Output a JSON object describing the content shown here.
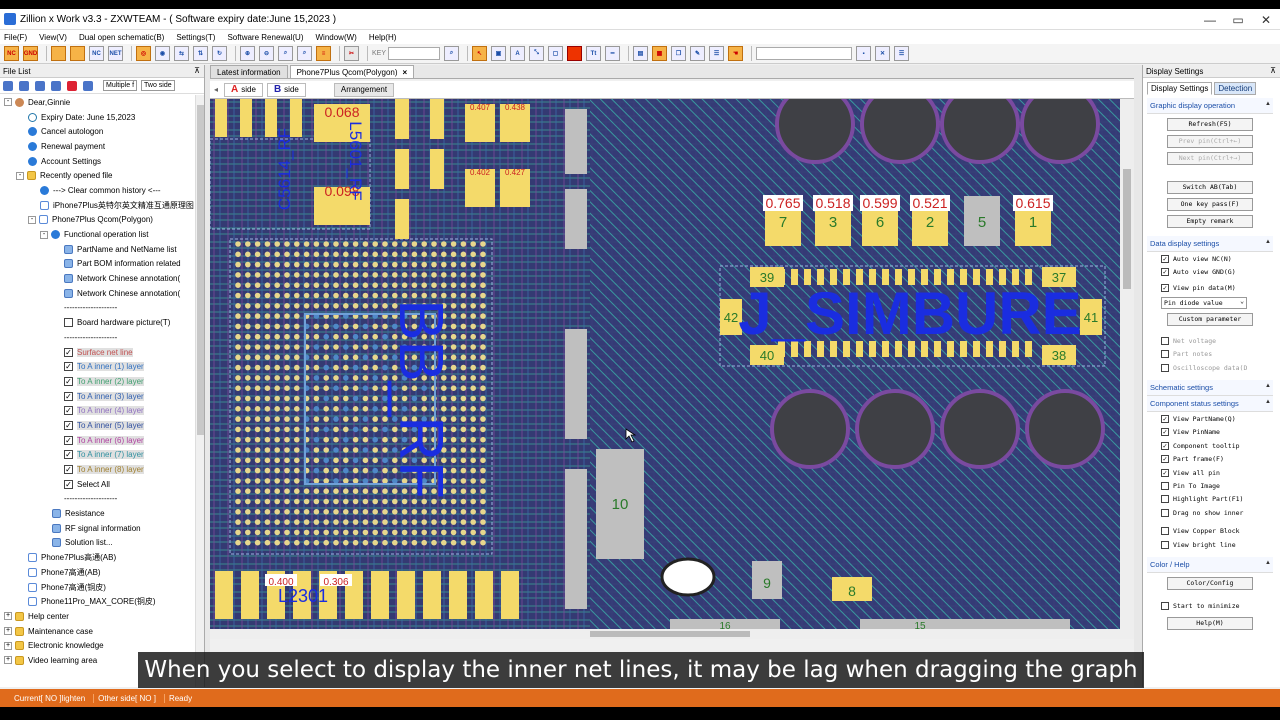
{
  "title": "Zillion x Work v3.3 - ZXWTEAM - ( Software expiry date:June 15,2023 )",
  "window_controls": [
    "—",
    "▭",
    "✕"
  ],
  "menu": [
    "File(F)",
    "View(V)",
    "Dual open schematic(B)",
    "Settings(T)",
    "Software Renewal(U)",
    "Window(W)",
    "Help(H)"
  ],
  "toolbar": {
    "key_label": "KEY"
  },
  "left_panel": {
    "header": "File List",
    "mode_select": "Multiple f",
    "side_select": "Two side",
    "tree": [
      {
        "indent": 0,
        "icon": "person",
        "label": "Dear,Ginnie",
        "exp": "-"
      },
      {
        "indent": 2,
        "icon": "clock",
        "label": "Expiry Date: June 15,2023"
      },
      {
        "indent": 2,
        "icon": "gear",
        "label": "Cancel autologon"
      },
      {
        "indent": 2,
        "icon": "gear",
        "label": "Renewal payment"
      },
      {
        "indent": 2,
        "icon": "gear",
        "label": "Account Settings"
      },
      {
        "indent": 1,
        "icon": "folder",
        "label": "Recently opened file",
        "exp": "-"
      },
      {
        "indent": 3,
        "icon": "gear",
        "label": "---> Clear common history <---"
      },
      {
        "indent": 3,
        "icon": "page",
        "label": "iPhone7Plus英特尔英文精准互通原理图"
      },
      {
        "indent": 2,
        "icon": "page",
        "label": "Phone7Plus Qcom(Polygon)",
        "exp": "-"
      },
      {
        "indent": 3,
        "icon": "gear",
        "label": "Functional operation list",
        "exp": "-"
      },
      {
        "indent": 5,
        "icon": "net",
        "label": "PartName and NetName list"
      },
      {
        "indent": 5,
        "icon": "net",
        "label": "Part BOM information related"
      },
      {
        "indent": 5,
        "icon": "net",
        "label": "Network Chinese annotation("
      },
      {
        "indent": 5,
        "icon": "net",
        "label": "Network Chinese annotation("
      },
      {
        "indent": 5,
        "icon": "none",
        "label": "--------------------"
      },
      {
        "indent": 5,
        "icon": "check",
        "checked": false,
        "label": "Board hardware picture(T)"
      },
      {
        "indent": 5,
        "icon": "none",
        "label": "--------------------"
      },
      {
        "indent": 5,
        "icon": "check",
        "checked": true,
        "label": "Surface net line",
        "color": "#c05050",
        "hl": true
      },
      {
        "indent": 5,
        "icon": "check",
        "checked": true,
        "label": "To A inner (1) layer",
        "color": "#3070c0",
        "hl": true
      },
      {
        "indent": 5,
        "icon": "check",
        "checked": true,
        "label": "To A inner (2) layer",
        "color": "#40a070",
        "hl": true
      },
      {
        "indent": 5,
        "icon": "check",
        "checked": true,
        "label": "To A inner (3) layer",
        "color": "#3060b0",
        "hl": true
      },
      {
        "indent": 5,
        "icon": "check",
        "checked": true,
        "label": "To A inner (4) layer",
        "color": "#9070c0",
        "hl": true
      },
      {
        "indent": 5,
        "icon": "check",
        "checked": true,
        "label": "To A inner (5) layer",
        "color": "#3050a0",
        "hl": true
      },
      {
        "indent": 5,
        "icon": "check",
        "checked": true,
        "label": "To A inner (6) layer",
        "color": "#b040a0",
        "hl": true
      },
      {
        "indent": 5,
        "icon": "check",
        "checked": true,
        "label": "To A inner (7) layer",
        "color": "#3090a0",
        "hl": true
      },
      {
        "indent": 5,
        "icon": "check",
        "checked": true,
        "label": "To A inner (8) layer",
        "color": "#a08030",
        "hl": true
      },
      {
        "indent": 5,
        "icon": "check",
        "checked": true,
        "label": "Select All"
      },
      {
        "indent": 5,
        "icon": "none",
        "label": "--------------------"
      },
      {
        "indent": 4,
        "icon": "net",
        "label": "Resistance"
      },
      {
        "indent": 4,
        "icon": "net",
        "label": "RF signal information"
      },
      {
        "indent": 4,
        "icon": "net",
        "label": "Solution list..."
      },
      {
        "indent": 2,
        "icon": "page",
        "label": "Phone7Plus高通(AB)"
      },
      {
        "indent": 2,
        "icon": "page",
        "label": "Phone7高通(AB)"
      },
      {
        "indent": 2,
        "icon": "page",
        "label": "Phone7高通(铜皮)"
      },
      {
        "indent": 2,
        "icon": "page",
        "label": "Phone11Pro_MAX_CORE(铜皮)"
      },
      {
        "indent": 0,
        "icon": "folder",
        "label": "Help center",
        "exp": "+"
      },
      {
        "indent": 0,
        "icon": "folder",
        "label": "Maintenance case",
        "exp": "+"
      },
      {
        "indent": 0,
        "icon": "folder",
        "label": "Electronic knowledge",
        "exp": "+"
      },
      {
        "indent": 0,
        "icon": "folder",
        "label": "Video learning area",
        "exp": "+"
      }
    ]
  },
  "center": {
    "tabs": [
      {
        "label": "Latest information",
        "active": false,
        "closable": false
      },
      {
        "label": "Phone7Plus Qcom(Polygon)",
        "active": true,
        "closable": true
      }
    ],
    "sides": [
      {
        "letter": "A",
        "label": "side",
        "cls": "a"
      },
      {
        "letter": "B",
        "label": "side",
        "cls": "b"
      }
    ],
    "arrangement": "Arrangement",
    "board": {
      "pad_values": [
        "0.765",
        "0.518",
        "0.599",
        "0.521",
        "0.615"
      ],
      "pad_numbers": [
        "7",
        "3",
        "6",
        "2",
        "5",
        "1"
      ],
      "connector_pins": [
        "39",
        "37",
        "42",
        "41",
        "40",
        "38"
      ],
      "big_labels": [
        "BB_RF",
        "J_SIMBURE"
      ],
      "small_values": [
        "0.068",
        "0.098",
        "0.407",
        "0.438",
        "0.402",
        "0.427",
        "0.400",
        "0.306"
      ],
      "ref_labels": [
        "C5614_RF",
        "L5601_RF",
        "L2301"
      ],
      "comp_numbers": [
        "10",
        "9",
        "8",
        "16",
        "15"
      ]
    }
  },
  "right_panel": {
    "header": "Display Settings",
    "tabs": [
      "Display Settings",
      "Detection"
    ],
    "sec_graphic": "Graphic display operation",
    "btn_refresh": "Refresh(F5)",
    "btn_prev": "Prev pin(Ctrl+←)",
    "btn_next": "Next pin(Ctrl+→)",
    "btn_switch": "Switch AB(Tab)",
    "btn_onekey": "One key pass(F)",
    "btn_empty": "Empty remark",
    "sec_data": "Data display settings",
    "data_checks": [
      {
        "label": "Auto view NC(N)",
        "checked": true,
        "dis": false
      },
      {
        "label": "Auto view GND(G)",
        "checked": true,
        "dis": false
      }
    ],
    "pin_check": {
      "label": "View pin data(M)",
      "checked": true
    },
    "pin_select": "Pin diode value",
    "btn_custom": "Custom parameter",
    "extra_checks": [
      {
        "label": "Net voltage",
        "checked": false,
        "dis": true
      },
      {
        "label": "Part notes",
        "checked": false,
        "dis": true
      },
      {
        "label": "Oscilloscope data(D",
        "checked": false,
        "dis": true
      }
    ],
    "sec_schematic": "Schematic settings",
    "sec_component": "Component status settings",
    "comp_checks": [
      {
        "label": "View PartName(Q)",
        "checked": true
      },
      {
        "label": "View PinName",
        "checked": true
      },
      {
        "label": "Component tooltip",
        "checked": true
      },
      {
        "label": "Part frame(F)",
        "checked": true
      },
      {
        "label": "View all pin",
        "checked": true
      },
      {
        "label": "Pin To Image",
        "checked": false
      },
      {
        "label": "Highlight Part(F1)",
        "checked": false
      },
      {
        "label": "Drag no show inner",
        "checked": false
      }
    ],
    "view_checks": [
      {
        "label": "View Copper Block",
        "checked": false
      },
      {
        "label": "View bright line",
        "checked": false
      }
    ],
    "sec_color": "Color / Help",
    "btn_color": "Color/Config",
    "start_min": {
      "label": "Start to minimize",
      "checked": false
    },
    "btn_help": "Help(M)"
  },
  "status": {
    "current": "Current[ NO ]lighten",
    "other": "Other side[ NO ]",
    "ready": "Ready"
  },
  "caption": "When you select to display the inner net lines, it may be lag when dragging the graph"
}
